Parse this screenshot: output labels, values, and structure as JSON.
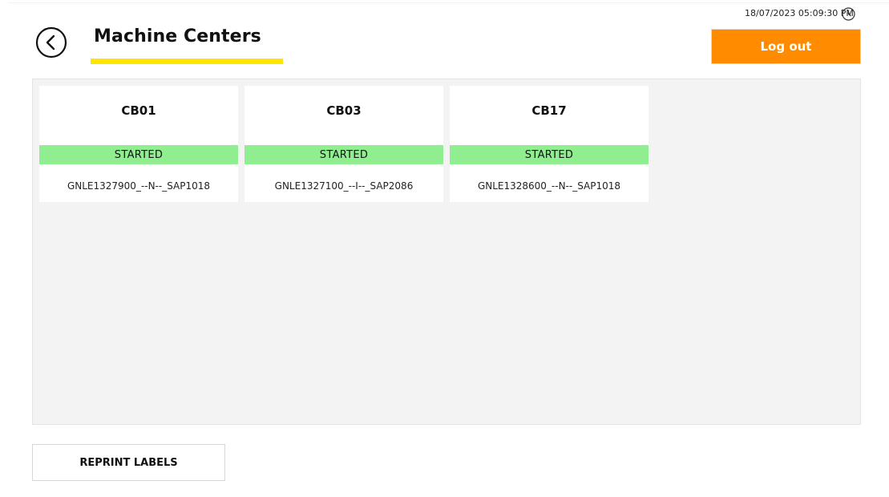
{
  "header": {
    "title": "Machine Centers",
    "datetime": "18/07/2023 05:09:30 PM",
    "logout_label": "Log out",
    "accent_color": "#ffe600",
    "logout_color": "#ff8c00"
  },
  "machine_centers": [
    {
      "name": "CB01",
      "status": "STARTED",
      "order": "GNLE1327900_--N--_SAP1018"
    },
    {
      "name": "CB03",
      "status": "STARTED",
      "order": "GNLE1327100_--I--_SAP2086"
    },
    {
      "name": "CB17",
      "status": "STARTED",
      "order": "GNLE1328600_--N--_SAP1018"
    }
  ],
  "status_color": "#90ee90",
  "footer": {
    "reprint_label": "REPRINT LABELS"
  }
}
